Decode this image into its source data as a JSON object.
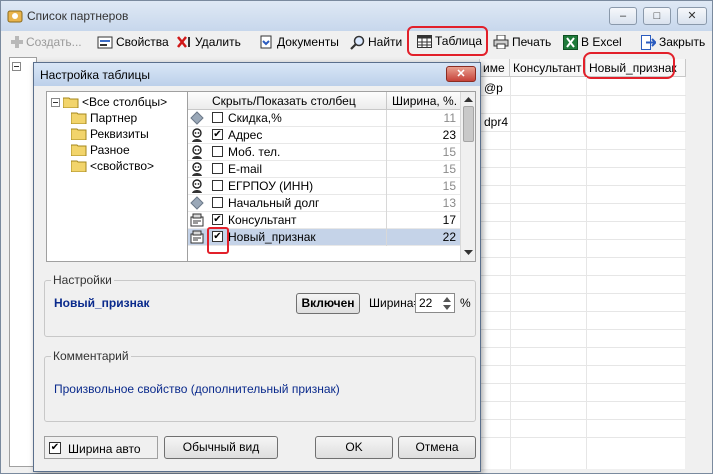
{
  "window": {
    "title": "Список партнеров",
    "minimize_glyph": "–",
    "maximize_glyph": "□",
    "close_glyph": "✕"
  },
  "toolbar": {
    "create": "Создать...",
    "properties": "Свойства",
    "delete": "Удалить",
    "documents": "Документы",
    "find": "Найти",
    "table": "Таблица",
    "print": "Печать",
    "excel": "В Excel",
    "close": "Закрыть"
  },
  "background_grid": {
    "columns": [
      "име",
      "Консультант",
      "Новый_признак"
    ],
    "cells": [
      "@p",
      "dpr4"
    ]
  },
  "dialog": {
    "title": "Настройка таблицы",
    "close_glyph": "✕",
    "tree": {
      "root": "<Все столбцы>",
      "children": [
        "Партнер",
        "Реквизиты",
        "Разное",
        "<свойство>"
      ]
    },
    "columns_header": {
      "name": "Скрыть/Показать столбец",
      "width": "Ширина, %."
    },
    "rows": [
      {
        "icon": "diamond-icon",
        "checked": false,
        "name": "Скидка,%",
        "width": "11"
      },
      {
        "icon": "person-icon",
        "checked": true,
        "name": "Адрес",
        "width": "23"
      },
      {
        "icon": "person-icon",
        "checked": false,
        "name": "Моб. тел.",
        "width": "15"
      },
      {
        "icon": "person-icon",
        "checked": false,
        "name": "E-mail",
        "width": "15"
      },
      {
        "icon": "person-icon",
        "checked": false,
        "name": "ЕГРПОУ (ИНН)",
        "width": "15"
      },
      {
        "icon": "diamond-icon",
        "checked": false,
        "name": "Начальный долг",
        "width": "13"
      },
      {
        "icon": "folder-card-icon",
        "checked": true,
        "name": "Консультант",
        "width": "17"
      },
      {
        "icon": "folder-card-icon",
        "checked": true,
        "name": "Новый_признак",
        "width": "22",
        "selected": true
      }
    ],
    "settings": {
      "label": "Настройки",
      "column_name": "Новый_признак",
      "toggle_button": "Включен",
      "width_label": "Ширина=",
      "width_value": "22",
      "percent": "%"
    },
    "comment": {
      "label": "Комментарий",
      "text": "Произвольное свойство (дополнительный признак)"
    },
    "footer": {
      "auto_width": "Ширина авто",
      "auto_width_checked": true,
      "normal_view": "Обычный вид",
      "ok": "OK",
      "cancel": "Отмена"
    }
  },
  "colors": {
    "highlight": "#e2202a",
    "selected_row": "#c5d3e8",
    "link_text": "#0a2a8c"
  }
}
